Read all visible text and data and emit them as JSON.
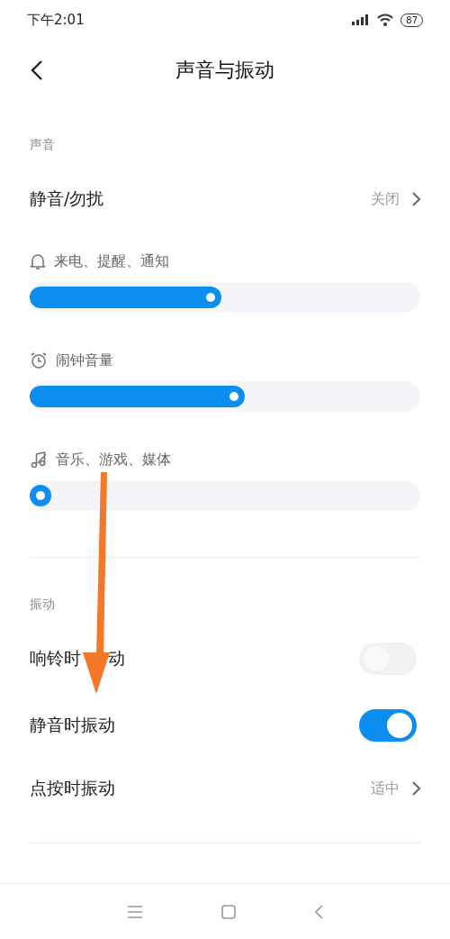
{
  "status_bar": {
    "time": "下午2:01",
    "battery": "87"
  },
  "header": {
    "title": "声音与振动"
  },
  "sections": [
    {
      "title": "声音",
      "items": [
        {
          "kind": "link",
          "label": "静音/勿扰",
          "value": "关闭"
        },
        {
          "kind": "slider",
          "label": "来电、提醒、通知",
          "level": 0.49
        },
        {
          "kind": "slider",
          "label": "闹钟音量",
          "level": 0.55
        },
        {
          "kind": "slider",
          "label": "音乐、游戏、媒体",
          "level": 0
        }
      ]
    },
    {
      "title": "振动",
      "items": [
        {
          "kind": "toggle",
          "label": "响铃时",
          "label_end": "动",
          "on": false
        },
        {
          "kind": "toggle",
          "label": "静音时振动",
          "on": true
        },
        {
          "kind": "link",
          "label": "点按时振动",
          "value": "适中"
        }
      ]
    }
  ],
  "overlay": {
    "kind": "arrow"
  }
}
